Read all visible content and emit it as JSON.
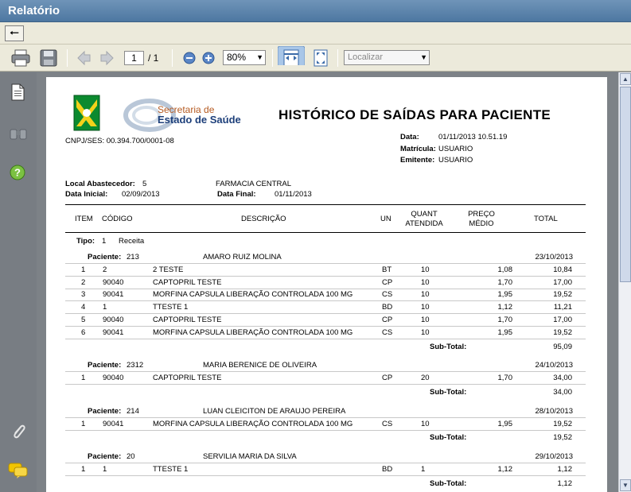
{
  "window": {
    "title": "Relatório"
  },
  "toolbar": {
    "page_current": "1",
    "page_total": "/ 1",
    "zoom": "80%",
    "find_placeholder": "Localizar"
  },
  "report": {
    "logo_line1": "Secretaria de",
    "logo_line2": "Estado de Saúde",
    "cnpj": "CNPJ/SES: 00.394.700/0001-08",
    "title": "HISTÓRICO DE SAÍDAS PARA PACIENTE",
    "meta": {
      "date_label": "Data:",
      "date_value": "01/11/2013 10.51.19",
      "mat_label": "Matrícula:",
      "mat_value": "USUARIO",
      "emit_label": "Emitente:",
      "emit_value": "USUARIO"
    },
    "local_label": "Local Abastecedor:",
    "local_code": "5",
    "local_name": "FARMACIA CENTRAL",
    "di_label": "Data Inicial:",
    "di_value": "02/09/2013",
    "df_label": "Data Final:",
    "df_value": "01/11/2013",
    "columns": {
      "item": "ITEM",
      "codigo": "CÓDIGO",
      "descricao": "DESCRIÇÃO",
      "un": "UN",
      "quant1": "QUANT",
      "quant2": "ATENDIDA",
      "preco1": "PREÇO",
      "preco2": "MÉDIO",
      "total": "TOTAL"
    },
    "tipo_label": "Tipo:",
    "tipo_code": "1",
    "tipo_name": "Receita",
    "patient_label": "Paciente:",
    "subtotal_label": "Sub-Total:",
    "patients": [
      {
        "id": "213",
        "name": "AMARO RUIZ MOLINA",
        "date": "23/10/2013",
        "subtotal": "95,09",
        "rows": [
          {
            "item": "1",
            "code": "2",
            "desc": "2 TESTE",
            "un": "BT",
            "qty": "10",
            "price": "1,08",
            "total": "10,84"
          },
          {
            "item": "2",
            "code": "90040",
            "desc": "CAPTOPRIL TESTE",
            "un": "CP",
            "qty": "10",
            "price": "1,70",
            "total": "17,00"
          },
          {
            "item": "3",
            "code": "90041",
            "desc": "MORFINA CAPSULA LIBERAÇÃO CONTROLADA 100 MG",
            "un": "CS",
            "qty": "10",
            "price": "1,95",
            "total": "19,52"
          },
          {
            "item": "4",
            "code": "1",
            "desc": "TTESTE 1",
            "un": "BD",
            "qty": "10",
            "price": "1,12",
            "total": "11,21"
          },
          {
            "item": "5",
            "code": "90040",
            "desc": "CAPTOPRIL TESTE",
            "un": "CP",
            "qty": "10",
            "price": "1,70",
            "total": "17,00"
          },
          {
            "item": "6",
            "code": "90041",
            "desc": "MORFINA CAPSULA LIBERAÇÃO CONTROLADA 100 MG",
            "un": "CS",
            "qty": "10",
            "price": "1,95",
            "total": "19,52"
          }
        ]
      },
      {
        "id": "2312",
        "name": "MARIA BERENICE DE OLIVEIRA",
        "date": "24/10/2013",
        "subtotal": "34,00",
        "rows": [
          {
            "item": "1",
            "code": "90040",
            "desc": "CAPTOPRIL TESTE",
            "un": "CP",
            "qty": "20",
            "price": "1,70",
            "total": "34,00"
          }
        ]
      },
      {
        "id": "214",
        "name": "LUAN CLEICITON DE ARAUJO PEREIRA",
        "date": "28/10/2013",
        "subtotal": "19,52",
        "rows": [
          {
            "item": "1",
            "code": "90041",
            "desc": "MORFINA CAPSULA LIBERAÇÃO CONTROLADA 100 MG",
            "un": "CS",
            "qty": "10",
            "price": "1,95",
            "total": "19,52"
          }
        ]
      },
      {
        "id": "20",
        "name": "SERVILIA MARIA DA SILVA",
        "date": "29/10/2013",
        "subtotal": "1,12",
        "rows": [
          {
            "item": "1",
            "code": "1",
            "desc": "TTESTE 1",
            "un": "BD",
            "qty": "1",
            "price": "1,12",
            "total": "1,12"
          }
        ]
      }
    ]
  }
}
